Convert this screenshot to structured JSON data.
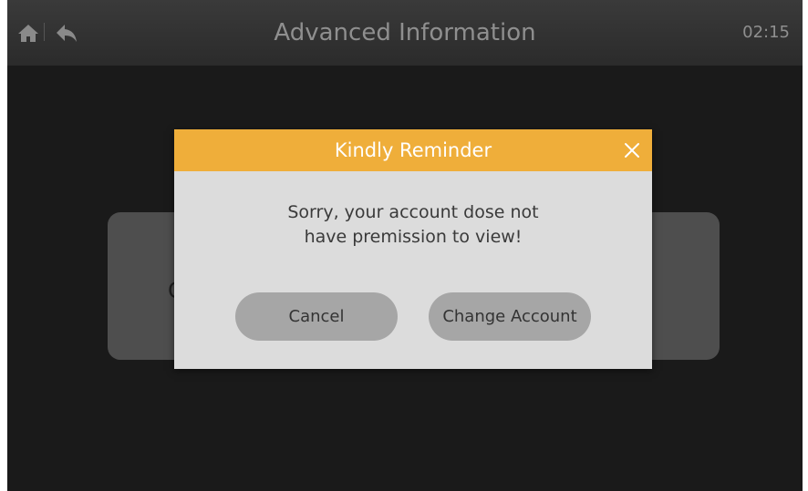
{
  "header": {
    "title": "Advanced Information",
    "time": "02:15",
    "home_icon": "home-icon",
    "back_icon": "back-icon"
  },
  "background_card": {
    "label_partial": "C"
  },
  "dialog": {
    "title": "Kindly Reminder",
    "close_icon": "close-icon",
    "message_line1": "Sorry, your account dose not",
    "message_line2": "have premission to view!",
    "cancel_label": "Cancel",
    "change_account_label": "Change Account"
  },
  "colors": {
    "header_bg": "#2f2f2f",
    "dialog_header": "#efae3a",
    "dialog_body": "#dcdcdc",
    "button_bg": "#a6a6a6",
    "screen_bg": "#1a1a1a"
  }
}
